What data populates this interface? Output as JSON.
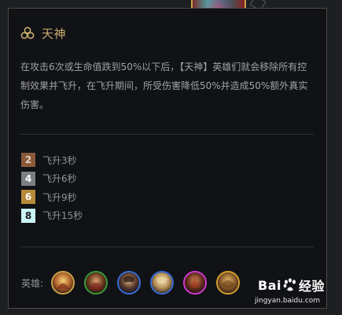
{
  "trait": {
    "name": "天神",
    "icon": "celestial-trait-icon",
    "accent_color": "#c8aa6e",
    "description": "在攻击6次或生命值跌到50%以下后，【天神】英雄们就会移除所有控制效果并飞升，在飞升期间，所受伤害降低50%并造成50%额外真实伤害。"
  },
  "tiers": [
    {
      "count": "2",
      "effect": "飞升3秒",
      "badge_color": "#8a5a3b",
      "text_color": "#e6d2c0"
    },
    {
      "count": "4",
      "effect": "飞升6秒",
      "badge_color": "#7c7f82",
      "text_color": "#ffffff"
    },
    {
      "count": "6",
      "effect": "飞升9秒",
      "badge_color": "#b68a38",
      "text_color": "#ffffff"
    },
    {
      "count": "8",
      "effect": "飞升15秒",
      "badge_color": "#c9f3f5",
      "text_color": "#1a1a1a"
    }
  ],
  "heroes": {
    "label": "英雄:",
    "items": [
      {
        "icon": "hero-portrait-1-icon",
        "border_color": "#c9a44a"
      },
      {
        "icon": "hero-portrait-2-icon",
        "border_color": "#3c9c3c"
      },
      {
        "icon": "hero-portrait-3-icon",
        "border_color": "#3a6fd8"
      },
      {
        "icon": "hero-portrait-4-icon",
        "border_color": "#3a6fd8"
      },
      {
        "icon": "hero-portrait-5-icon",
        "border_color": "#d33bd3"
      },
      {
        "icon": "hero-portrait-6-icon",
        "border_color": "#d9a12b"
      }
    ]
  },
  "watermark": {
    "brand_prefix": "Bai",
    "brand_suffix": "经验",
    "url": "jingyan.baidu.com"
  }
}
